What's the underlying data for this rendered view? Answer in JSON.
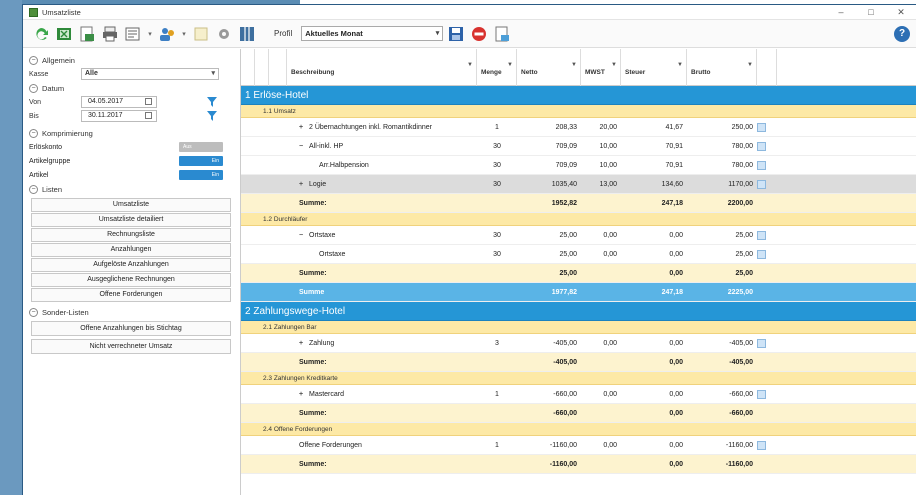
{
  "window": {
    "title": "Umsatzliste",
    "min": "–",
    "max": "□",
    "close": "✕"
  },
  "toolbar": {
    "profil_label": "Profil",
    "profil_value": "Aktuelles Monat",
    "help": "?"
  },
  "left": {
    "allgemein": "Allgemein",
    "kasse_label": "Kasse",
    "kasse_value": "Alle",
    "datum": "Datum",
    "von_label": "Von",
    "von_value": "04.05.2017",
    "bis_label": "Bis",
    "bis_value": "30.11.2017",
    "komprimierung": "Komprimierung",
    "erloeskonto": "Erlöskonto",
    "erloeskonto_toggle": "Aus",
    "artikelgruppe": "Artikelgruppe",
    "artikelgruppe_toggle": "Ein",
    "artikel": "Artikel",
    "artikel_toggle": "Ein",
    "listen": "Listen",
    "list_buttons": [
      "Umsatzliste",
      "Umsatzliste detailiert",
      "Rechnungsliste",
      "Anzahlungen",
      "Aufgelöste Anzahlungen",
      "Ausgeglichene Rechnungen",
      "Offene Forderungen"
    ],
    "sonder": "Sonder-Listen",
    "sonder_buttons": [
      "Offene Anzahlungen bis Stichtag",
      "Nicht verrechneter Umsatz"
    ]
  },
  "columns": {
    "beschreibung": "Beschreibung",
    "menge": "Menge",
    "netto": "Netto",
    "mwst": "MWST",
    "steuer": "Steuer",
    "brutto": "Brutto"
  },
  "groups": {
    "g1": "1 Erlöse-Hotel",
    "g1_1": "1.1 Umsatz",
    "g1_2": "1.2 Durchläufer",
    "g2": "2 Zahlungswege-Hotel",
    "g2_1": "2.1 Zahlungen Bar",
    "g2_3": "2.3 Zahlungen Kreditkarte",
    "g2_4": "2.4 Offene Forderungen"
  },
  "rows": {
    "r1": {
      "desc": "2 Übernachtungen inkl. Romantikdinner",
      "menge": "1",
      "netto": "208,33",
      "mwst": "20,00",
      "steuer": "41,67",
      "brutto": "250,00"
    },
    "r2": {
      "desc": "All-inkl. HP",
      "menge": "30",
      "netto": "709,09",
      "mwst": "10,00",
      "steuer": "70,91",
      "brutto": "780,00"
    },
    "r3": {
      "desc": "Arr.Halbpension",
      "menge": "30",
      "netto": "709,09",
      "mwst": "10,00",
      "steuer": "70,91",
      "brutto": "780,00"
    },
    "r4": {
      "desc": "Logie",
      "menge": "30",
      "netto": "1035,40",
      "mwst": "13,00",
      "steuer": "134,60",
      "brutto": "1170,00"
    },
    "s1": {
      "desc": "Summe:",
      "netto": "1952,82",
      "steuer": "247,18",
      "brutto": "2200,00"
    },
    "r5": {
      "desc": "Ortstaxe",
      "menge": "30",
      "netto": "25,00",
      "mwst": "0,00",
      "steuer": "0,00",
      "brutto": "25,00"
    },
    "r6": {
      "desc": "Ortstaxe",
      "menge": "30",
      "netto": "25,00",
      "mwst": "0,00",
      "steuer": "0,00",
      "brutto": "25,00"
    },
    "s2": {
      "desc": "Summe:",
      "netto": "25,00",
      "steuer": "0,00",
      "brutto": "25,00"
    },
    "s3": {
      "desc": "Summe",
      "netto": "1977,82",
      "steuer": "247,18",
      "brutto": "2225,00"
    },
    "r7": {
      "desc": "Zahlung",
      "menge": "3",
      "netto": "-405,00",
      "mwst": "0,00",
      "steuer": "0,00",
      "brutto": "-405,00"
    },
    "s4": {
      "desc": "Summe:",
      "netto": "-405,00",
      "steuer": "0,00",
      "brutto": "-405,00"
    },
    "r8": {
      "desc": "Mastercard",
      "menge": "1",
      "netto": "-660,00",
      "mwst": "0,00",
      "steuer": "0,00",
      "brutto": "-660,00"
    },
    "s5": {
      "desc": "Summe:",
      "netto": "-660,00",
      "steuer": "0,00",
      "brutto": "-660,00"
    },
    "r9": {
      "desc": "Offene Forderungen",
      "menge": "1",
      "netto": "-1160,00",
      "mwst": "0,00",
      "steuer": "0,00",
      "brutto": "-1160,00"
    },
    "s6": {
      "desc": "Summe:",
      "netto": "-1160,00",
      "steuer": "0,00",
      "brutto": "-1160,00"
    }
  },
  "colors": {
    "group_blue": "#2596d6",
    "sub_yellow": "#fde9a6",
    "sum_yellow": "#fdf3cf",
    "sum_blue": "#5ab4e6"
  }
}
